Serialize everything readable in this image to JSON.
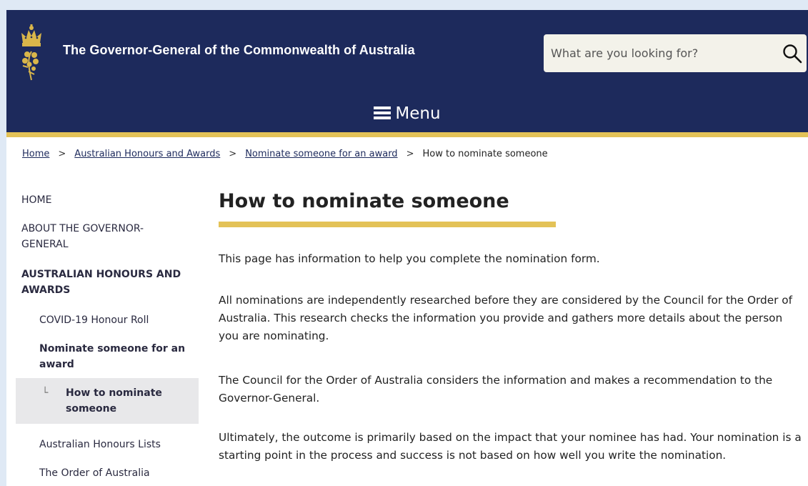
{
  "header": {
    "site_title": "The Governor-General of the Commonwealth of Australia",
    "search_placeholder": "What are you looking for?",
    "menu_label": "Menu",
    "bg_color": "#1d2a5c",
    "accent_color": "#e3c257"
  },
  "breadcrumb": {
    "items": [
      "Home",
      "Australian Honours and Awards",
      "Nominate someone for an award",
      "How to nominate someone"
    ],
    "separator": ">"
  },
  "sidebar": {
    "items": [
      {
        "label": "HOME"
      },
      {
        "label": "ABOUT THE GOVERNOR-GENERAL"
      },
      {
        "label": "AUSTRALIAN HONOURS AND AWARDS"
      },
      {
        "label": "COVID-19 Honour Roll"
      },
      {
        "label": "Nominate someone for an award"
      },
      {
        "label": "How to nominate someone",
        "prefix": "└"
      },
      {
        "label": "Australian Honours Lists"
      },
      {
        "label": "The Order of Australia"
      }
    ]
  },
  "main": {
    "title": "How to nominate someone",
    "paragraphs": [
      "This page has information to help you complete the nomination form.",
      "All nominations are independently researched before they are considered by the Council for the Order of Australia. This research checks the information you provide and gathers more details about the person you are nominating.",
      "The Council for the Order of Australia considers the information and makes a recommendation to the Governor-General.",
      "Ultimately, the outcome is primarily based on the impact that your nominee has had. Your nomination is a starting point in the process and success is not based on how well you write the nomination."
    ]
  }
}
